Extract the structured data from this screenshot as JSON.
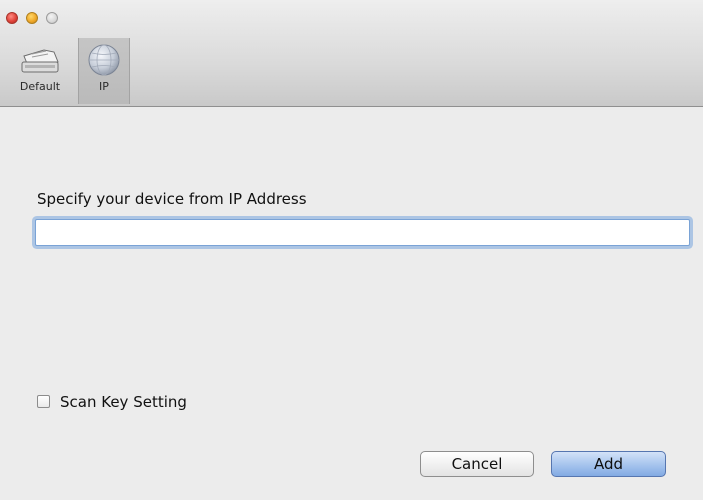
{
  "window": {
    "controls": {
      "close_icon": "close-icon",
      "minimize_icon": "minimize-icon",
      "zoom_icon": "zoom-icon"
    }
  },
  "toolbar": {
    "items": [
      {
        "label": "Default",
        "icon": "scanner-icon",
        "selected": false
      },
      {
        "label": "IP",
        "icon": "globe-icon",
        "selected": true
      }
    ]
  },
  "main": {
    "prompt": "Specify your device from IP Address",
    "ip_input": {
      "value": "",
      "placeholder": ""
    },
    "scan_key": {
      "label": "Scan Key Setting",
      "checked": false
    }
  },
  "buttons": {
    "cancel": "Cancel",
    "add": "Add"
  },
  "colors": {
    "window_bg": "#ececec",
    "focus_ring": "#78a5de",
    "default_button": "#a9c6ee"
  }
}
